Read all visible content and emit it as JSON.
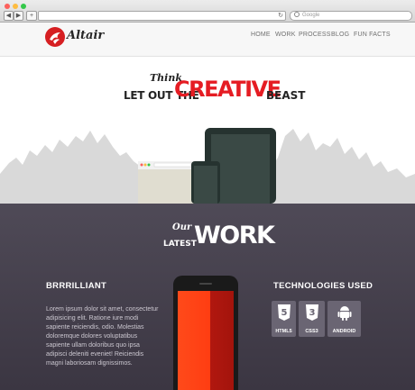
{
  "browser": {
    "back_label": "◀",
    "forward_label": "▶",
    "add_tab_label": "+",
    "reload_glyph": "↻",
    "search_placeholder": "Google",
    "traffic_colors": [
      "#fc605c",
      "#fdbc40",
      "#34c84a"
    ]
  },
  "site": {
    "logo_text": "Altair",
    "nav": [
      "HOME",
      "WORK",
      "PROCESS",
      "BLOG",
      "FUN FACTS"
    ],
    "hero": {
      "think": "Think",
      "line_left": "LET OUT THE",
      "highlight": "CREATIVE",
      "line_right": "BEAST"
    },
    "work": {
      "our": "Our",
      "latest": "LATEST",
      "title": "WORK",
      "project_title": "BRRRILLIANT",
      "project_text": "Lorem ipsum dolor sit amet, consectetur adipisicing elit. Ratione iure modi sapiente reiciendis, odio. Molestias doloremque dolores voluptatibus sapiente ullam doloribus quo ipsa adipisci deleniti eveniet! Reiciendis magni laboriosam dignissimos.",
      "technologies_title": "TECHNOLOGIES USED",
      "technologies": [
        {
          "label": "HTML5",
          "icon": "html5-icon",
          "glyph": "5"
        },
        {
          "label": "CSS3",
          "icon": "css3-icon",
          "glyph": "3"
        },
        {
          "label": "ANDROID",
          "icon": "android-icon"
        }
      ]
    }
  },
  "colors": {
    "accent": "#e51c23",
    "work_bg": "#4a4552",
    "badge_bg": "#6a6573"
  }
}
